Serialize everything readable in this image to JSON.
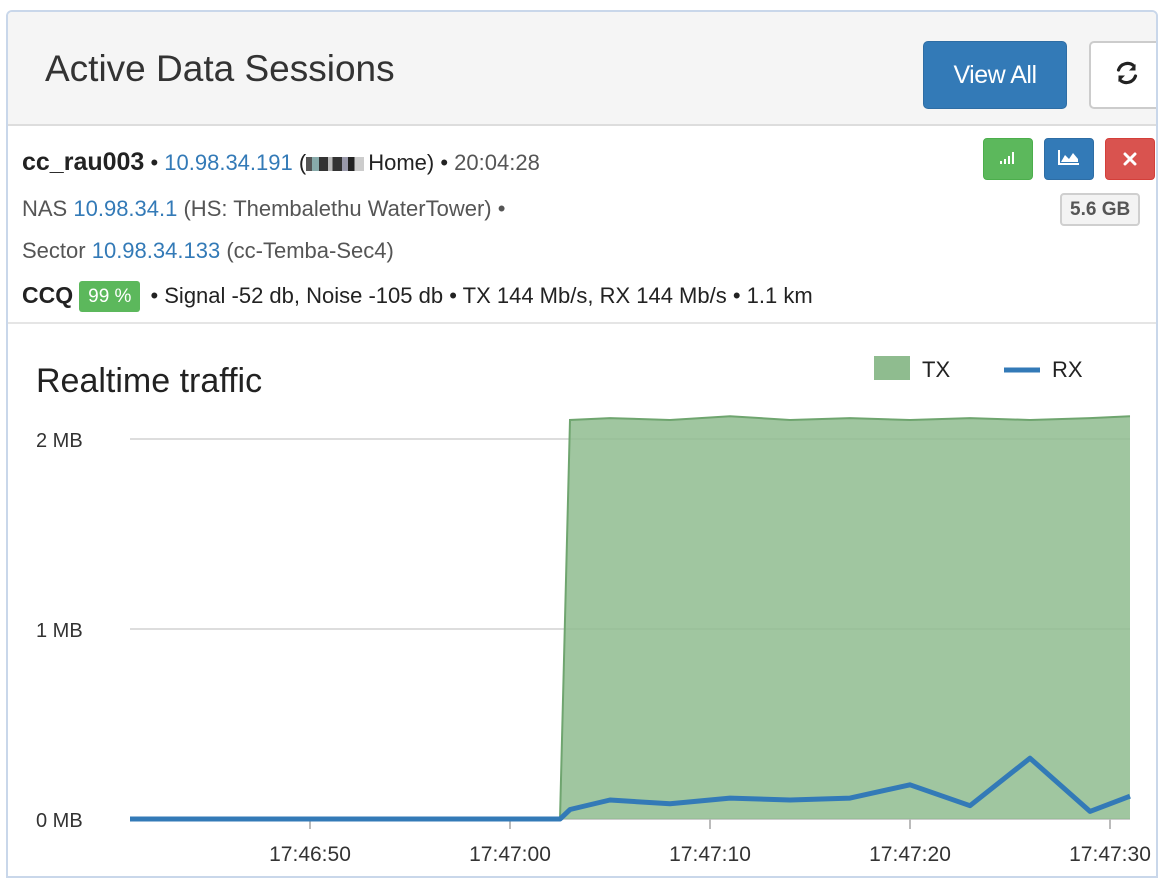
{
  "header": {
    "title": "Active Data Sessions",
    "view_all_label": "View All",
    "refresh_icon": "refresh-icon"
  },
  "session": {
    "username": "cc_rau003",
    "ip": "10.98.34.191",
    "location_suffix": "Home)",
    "time": "20:04:28",
    "nas_label": "NAS",
    "nas_ip": "10.98.34.1",
    "nas_hotspot": "(HS: Thembalethu WaterTower) •",
    "sector_label": "Sector",
    "sector_ip": "10.98.34.133",
    "sector_name": "(cc-Temba-Sec4)",
    "ccq_label": "CCQ",
    "ccq_value": "99 %",
    "stats": "• Signal -52 db, Noise -105 db  • TX 144 Mb/s, RX 144 Mb/s  • 1.1 km",
    "usage": "5.6 GB",
    "actions": [
      "signal-icon",
      "area-chart-icon",
      "close-icon"
    ],
    "colors": {
      "success": "#5cb85c",
      "primary": "#337ab7",
      "danger": "#d9534f"
    }
  },
  "chart_data": {
    "type": "area",
    "title": "Realtime traffic",
    "x_ticks": [
      "17:46:50",
      "17:47:00",
      "17:47:10",
      "17:47:20",
      "17:47:30"
    ],
    "y_ticks": [
      "0 MB",
      "1 MB",
      "2 MB"
    ],
    "ylim": [
      0,
      2.3
    ],
    "grid": true,
    "legend_position": "top-right",
    "x": [
      "17:46:41",
      "17:46:44",
      "17:46:47",
      "17:46:50",
      "17:46:53",
      "17:46:56",
      "17:46:59",
      "17:47:02",
      "17:47:02.5",
      "17:47:03",
      "17:47:05",
      "17:47:08",
      "17:47:11",
      "17:47:14",
      "17:47:17",
      "17:47:20",
      "17:47:23",
      "17:47:26",
      "17:47:29",
      "17:47:31"
    ],
    "series": [
      {
        "name": "TX",
        "kind": "area",
        "color": "#8fbc8f",
        "values": [
          0,
          0,
          0,
          0,
          0,
          0,
          0,
          0,
          0,
          2.1,
          2.11,
          2.1,
          2.12,
          2.1,
          2.11,
          2.1,
          2.11,
          2.1,
          2.11,
          2.12
        ]
      },
      {
        "name": "RX",
        "kind": "line",
        "color": "#337ab7",
        "values": [
          0,
          0,
          0,
          0,
          0,
          0,
          0,
          0,
          0,
          0.05,
          0.1,
          0.08,
          0.11,
          0.1,
          0.11,
          0.18,
          0.07,
          0.32,
          0.04,
          0.12
        ]
      }
    ]
  }
}
